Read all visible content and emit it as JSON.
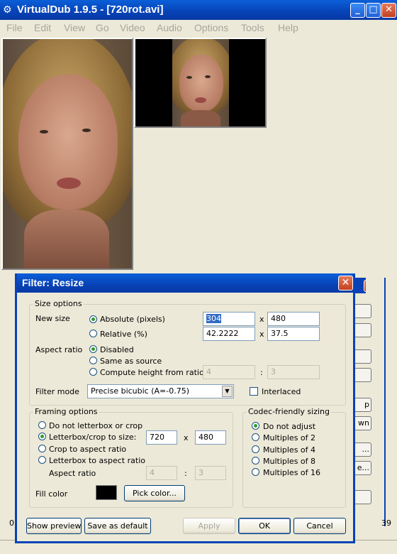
{
  "window": {
    "title": "VirtualDub 1.9.5 - [720rot.avi]",
    "minimize": "_",
    "maximize": "□",
    "close": "✕"
  },
  "menu": [
    "File",
    "Edit",
    "View",
    "Go",
    "Video",
    "Audio",
    "Options",
    "Tools",
    "Help"
  ],
  "timeline": {
    "start": "0",
    "end": "39"
  },
  "background_dialog": {
    "button_labels": [
      "",
      "",
      "",
      "",
      "p",
      "wn",
      "...",
      "e...",
      ""
    ]
  },
  "dialog": {
    "title": "Filter: Resize",
    "size_options": {
      "legend": "Size options",
      "new_size_label": "New size",
      "absolute_label": "Absolute (pixels)",
      "absolute_width": "304",
      "absolute_height": "480",
      "relative_label": "Relative (%)",
      "relative_width": "42.2222",
      "relative_height": "37.5",
      "x_sep": "x",
      "aspect_label": "Aspect ratio",
      "aspect_disabled": "Disabled",
      "aspect_same": "Same as source",
      "aspect_compute": "Compute height from ratio:",
      "ratio_a": "4",
      "ratio_b": "3",
      "colon": ":",
      "filter_mode_label": "Filter mode",
      "filter_mode_value": "Precise bicubic (A=-0.75)",
      "interlaced_label": "Interlaced"
    },
    "framing": {
      "legend": "Framing options",
      "no_letterbox": "Do not letterbox or crop",
      "letterbox": "Letterbox/crop to size:",
      "lb_width": "720",
      "lb_height": "480",
      "crop_aspect": "Crop to aspect ratio",
      "letterbox_aspect": "Letterbox to aspect ratio",
      "aspect_label": "Aspect ratio",
      "ar_a": "4",
      "ar_b": "3",
      "fill_color_label": "Fill color",
      "fill_color": "#000000",
      "pick_color": "Pick color..."
    },
    "codec": {
      "legend": "Codec-friendly sizing",
      "options": [
        "Do not adjust",
        "Multiples of 2",
        "Multiples of 4",
        "Multiples of 8",
        "Multiples of 16"
      ]
    },
    "buttons": {
      "show_preview": "Show preview",
      "save_default": "Save as default",
      "apply": "Apply",
      "ok": "OK",
      "cancel": "Cancel"
    }
  }
}
